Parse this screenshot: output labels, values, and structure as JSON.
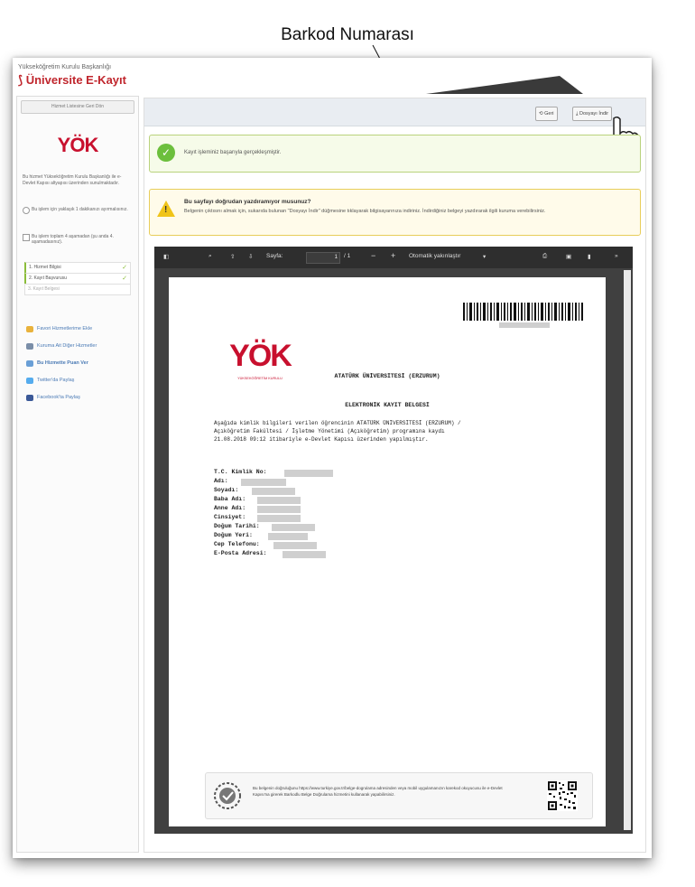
{
  "annotation": {
    "label": "Barkod Numarası"
  },
  "brand": {
    "top": "Yükseköğretim Kurulu Başkanlığı",
    "name": "Üniversite E-Kayıt"
  },
  "sidebar": {
    "back_button": "Hizmet Listesine Geri Dön",
    "logo_text": "YÖK",
    "info": "Bu hizmet Yükseköğretim Kurulu Başkanlığı ile e-Devlet Kapısı altyapısı üzerinden sunulmaktadır.",
    "radio_1": "Bu işlem için yaklaşık 1 dakikanızı ayırmalısınız.",
    "radio_2": "Bu işlem toplam 4 aşamadan (şu anda 4. aşamadasınız).",
    "steps": [
      {
        "label": "1. Hizmet Bilgisi",
        "done": true
      },
      {
        "label": "2. Kayıt Başvurusu",
        "done": true
      },
      {
        "label": "3. Kayıt Belgesi",
        "done": false
      }
    ],
    "links": [
      {
        "label": "Favori Hizmetlerime Ekle",
        "color": "#e9b23c"
      },
      {
        "label": "Kuruma Ait Diğer Hizmetler",
        "color": "#7a8ea8"
      },
      {
        "label": "Bu Hizmette Puan Ver",
        "color": "#6a9fd6"
      },
      {
        "label": "Twitter'da Paylaş",
        "color": "#55acee"
      },
      {
        "label": "Facebook'ta Paylaş",
        "color": "#3b5998"
      }
    ]
  },
  "toolbar": {
    "back_label": "Geri",
    "download_label": "Dosyayı İndir"
  },
  "alerts": {
    "success": "Kayıt işleminiz başarıyla gerçekleşmiştir.",
    "warning_title": "Bu sayfayı doğrudan yazdıramıyor musunuz?",
    "warning_body": "Belgenin çıktısını almak için, sukarıda bulunan \"Dosyayı İndir\" düğmesine tıklayarak bilgisayarınıza indiriniz. İndirdiğiniz belgeyi yazdırarak ilgili kuruma verebilirsiniz."
  },
  "viewer": {
    "page_label": "Sayfa:",
    "page_current": "1",
    "page_total": "/ 1",
    "zoom": "Otomatik yakınlaştır"
  },
  "document": {
    "logo_caption": "YÜKSEKÖĞRETİM KURULU",
    "university": "ATATÜRK ÜNİVERSİTESİ (ERZURUM)",
    "title": "ELEKTRONİK KAYIT BELGESİ",
    "body_1": "Aşağıda kimlik bilgileri verilen öğrencinin ATATÜRK ÜNİVERSİTESİ (ERZURUM) /",
    "body_2": "Açıköğretim Fakültesi / İşletme Yönetimi (Açıköğretim) programına kaydı",
    "body_3": "21.08.2018 09:12 itibariyle e-Devlet Kapısı üzerinden yapılmıştır.",
    "fields": [
      "T.C. Kimlik No:",
      "Adı:",
      "Soyadı:",
      "Baba Adı:",
      "Anne Adı:",
      "Cinsiyet:",
      "Doğum Tarihi:",
      "Doğum Yeri:",
      "Cep Telefonu:",
      "E-Posta Adresi:"
    ],
    "footer": "Bu belgenin doğruluğunu https://www.turkiye.gov.tr/belge-dogrulama adresinden veya mobil uygulamanızın karekod okuyucusu ile e-Devlet Kapısı'na girerek Barkodlu Belge Doğrulama hizmetini kullanarak yapabilirsiniz."
  }
}
